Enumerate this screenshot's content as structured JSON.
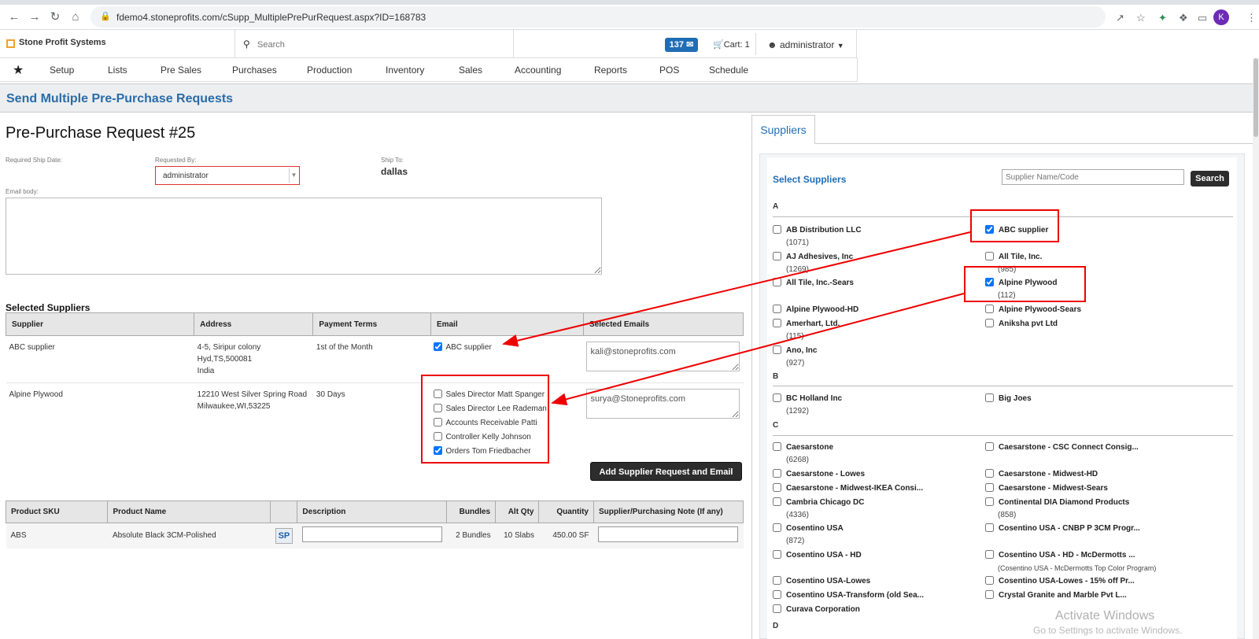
{
  "browser": {
    "url": "fdemo4.stoneprofits.com/cSupp_MultiplePrePurRequest.aspx?ID=168783",
    "avatar_letter": "K"
  },
  "app": {
    "brand": "Stone Profit Systems",
    "search_placeholder": "Search",
    "message_count": "137",
    "cart": "Cart: 1",
    "user": "administrator"
  },
  "menu": [
    "Setup",
    "Lists",
    "Pre Sales",
    "Purchases",
    "Production",
    "Inventory",
    "Sales",
    "Accounting",
    "Reports",
    "POS",
    "Schedule"
  ],
  "page_title": "Send Multiple Pre-Purchase Requests",
  "request": {
    "title": "Pre-Purchase Request #25",
    "ship_date_label": "Required Ship Date:",
    "requested_by_label": "Requested By:",
    "requested_by": "administrator",
    "ship_to_label": "Ship To:",
    "ship_to": "dallas",
    "email_body_label": "Email body:"
  },
  "selected_suppliers": {
    "heading": "Selected Suppliers",
    "columns": [
      "Supplier",
      "Address",
      "Payment Terms",
      "Email",
      "Selected Emails"
    ],
    "rows": [
      {
        "supplier": "ABC supplier",
        "address": [
          "4-5, Siripur colony",
          "Hyd,TS,500081",
          "India"
        ],
        "terms": "1st of the Month",
        "emails": [
          {
            "label": "ABC supplier",
            "checked": true
          }
        ],
        "selected_email": "kali@stoneprofits.com"
      },
      {
        "supplier": "Alpine Plywood",
        "address": [
          "12210 West Silver Spring Road",
          "Milwaukee,WI,53225"
        ],
        "terms": "30 Days",
        "emails": [
          {
            "label": "Sales Director Matt Spanger",
            "checked": false
          },
          {
            "label": "Sales Director Lee Rademan",
            "checked": false
          },
          {
            "label": "Accounts Receivable Patti",
            "checked": false
          },
          {
            "label": "Controller Kelly Johnson",
            "checked": false
          },
          {
            "label": "Orders Tom Friedbacher",
            "checked": true
          }
        ],
        "selected_email": "surya@Stoneprofits.com"
      }
    ],
    "add_button": "Add Supplier Request and Email"
  },
  "products": {
    "columns": [
      "Product SKU",
      "Product Name",
      "",
      "Description",
      "Bundles",
      "Alt Qty",
      "Quantity",
      "Supplier/Purchasing Note (If any)"
    ],
    "rows": [
      {
        "sku": "ABS",
        "name": "Absolute Black 3CM-Polished",
        "sp": "SP",
        "bundles": "2 Bundles",
        "alt_qty": "10 Slabs",
        "quantity": "450.00 SF"
      }
    ]
  },
  "suppliers_panel": {
    "tab": "Suppliers",
    "title": "Select Suppliers",
    "search_placeholder": "Supplier Name/Code",
    "search_button": "Search",
    "groups": [
      {
        "letter": "A"
      },
      {
        "letter": "B"
      },
      {
        "letter": "C"
      },
      {
        "letter": "D"
      }
    ],
    "items": [
      {
        "name": "AB Distribution LLC",
        "count": "(1071)",
        "checked": false
      },
      {
        "name": "ABC supplier",
        "count": "",
        "checked": true
      },
      {
        "name": "AJ Adhesives, Inc",
        "count": "(1269)",
        "checked": false
      },
      {
        "name": "All Tile, Inc.",
        "count": "(985)",
        "checked": false
      },
      {
        "name": "All Tile, Inc.-Sears",
        "count": "",
        "checked": false
      },
      {
        "name": "Alpine Plywood",
        "count": "(112)",
        "checked": true
      },
      {
        "name": "Alpine Plywood-HD",
        "count": "",
        "checked": false
      },
      {
        "name": "Alpine Plywood-Sears",
        "count": "",
        "checked": false
      },
      {
        "name": "Amerhart, Ltd.",
        "count": "(115)",
        "checked": false
      },
      {
        "name": "Aniksha pvt Ltd",
        "count": "",
        "checked": false
      },
      {
        "name": "Ano, Inc",
        "count": "(927)",
        "checked": false
      },
      {
        "name": "BC Holland Inc",
        "count": "(1292)",
        "checked": false
      },
      {
        "name": "Big Joes",
        "count": "",
        "checked": false
      },
      {
        "name": "Caesarstone",
        "count": "(6268)",
        "checked": false
      },
      {
        "name": "Caesarstone - CSC Connect Consig...",
        "count": "",
        "checked": false
      },
      {
        "name": "Caesarstone - Lowes",
        "count": "",
        "checked": false
      },
      {
        "name": "Caesarstone - Midwest-HD",
        "count": "",
        "checked": false
      },
      {
        "name": "Caesarstone - Midwest-IKEA Consi...",
        "count": "",
        "checked": false
      },
      {
        "name": "Caesarstone - Midwest-Sears",
        "count": "",
        "checked": false
      },
      {
        "name": "Cambria Chicago DC",
        "count": "(4336)",
        "checked": false
      },
      {
        "name": "Continental DIA Diamond Products",
        "count": "(858)",
        "checked": false
      },
      {
        "name": "Cosentino USA",
        "count": "(872)",
        "checked": false
      },
      {
        "name": "Cosentino USA - CNBP P 3CM Progr...",
        "count": "",
        "checked": false
      },
      {
        "name": "Cosentino USA - HD",
        "count": "",
        "checked": false
      },
      {
        "name": "Cosentino USA - HD - McDermotts ...",
        "count": "(Cosentino USA - McDermotts Top Color Program)",
        "checked": false
      },
      {
        "name": "Cosentino USA-Lowes",
        "count": "",
        "checked": false
      },
      {
        "name": "Cosentino USA-Lowes - 15% off Pr...",
        "count": "",
        "checked": false
      },
      {
        "name": "Cosentino USA-Transform (old Sea...",
        "count": "",
        "checked": false
      },
      {
        "name": "Crystal Granite and Marble Pvt L...",
        "count": "",
        "checked": false
      },
      {
        "name": "Curava Corporation",
        "count": "",
        "checked": false
      }
    ]
  },
  "watermark": {
    "line1": "Activate Windows",
    "line2": "Go to Settings to activate Windows."
  }
}
